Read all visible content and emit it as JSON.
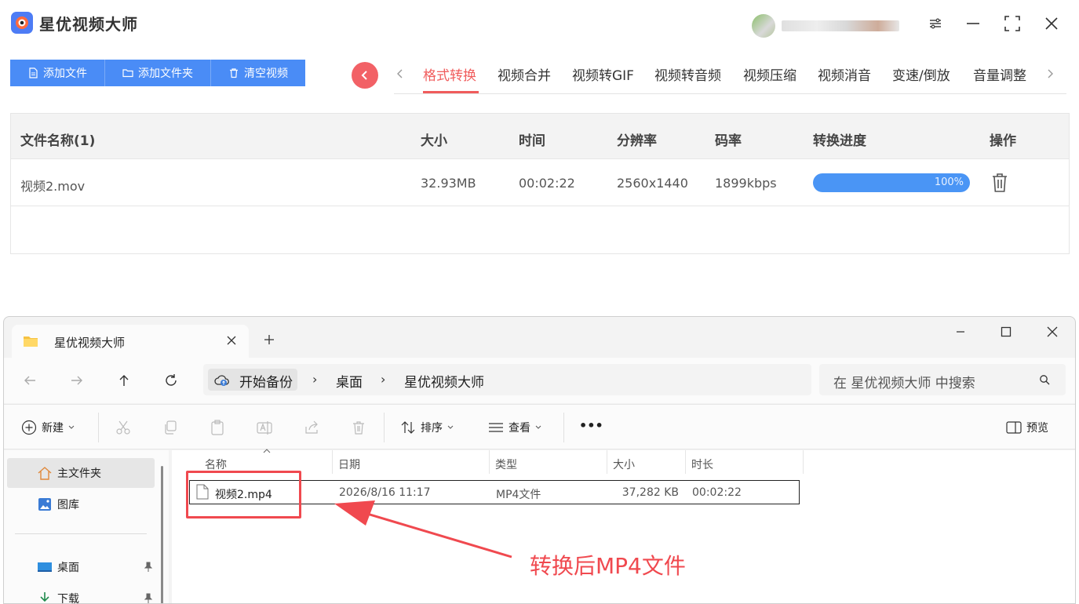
{
  "app": {
    "title": "星优视频大师",
    "window_controls": [
      "settings-icon",
      "minimize-icon",
      "maximize-icon",
      "close-icon"
    ]
  },
  "toolbar": {
    "add_file": "添加文件",
    "add_folder": "添加文件夹",
    "clear_videos": "清空视频"
  },
  "tabs": [
    "格式转换",
    "视频合并",
    "视频转GIF",
    "视频转音频",
    "视频压缩",
    "视频消音",
    "变速/倒放",
    "音量调整"
  ],
  "active_tab": "格式转换",
  "table": {
    "headers": {
      "name": "文件名称(1)",
      "size": "大小",
      "time": "时间",
      "resolution": "分辨率",
      "bitrate": "码率",
      "progress": "转换进度",
      "action": "操作"
    },
    "rows": [
      {
        "name": "视频2.mov",
        "size": "32.93MB",
        "time": "00:02:22",
        "resolution": "2560x1440",
        "bitrate": "1899kbps",
        "progress_label": "100%",
        "progress_value": 1.0
      }
    ]
  },
  "explorer": {
    "tab_title": "星优视频大师",
    "breadcrumb": [
      "开始备份",
      "桌面",
      "星优视频大师"
    ],
    "search_placeholder": "在 星优视频大师 中搜索",
    "commands": {
      "new": "新建",
      "sort": "排序",
      "view": "查看",
      "more": "•••",
      "preview": "预览"
    },
    "sidebar": [
      {
        "label": "主文件夹",
        "icon": "home-icon"
      },
      {
        "label": "图库",
        "icon": "gallery-icon"
      },
      {
        "label": "桌面",
        "icon": "desktop-icon"
      },
      {
        "label": "下载",
        "icon": "download-icon"
      }
    ],
    "columns": {
      "name": "名称",
      "date": "日期",
      "type": "类型",
      "size": "大小",
      "duration": "时长"
    },
    "files": [
      {
        "name": "视频2.mp4",
        "date": "2026/8/16 11:17",
        "type": "MP4文件",
        "size": "37,282 KB",
        "duration": "00:02:22"
      }
    ]
  },
  "annotation": "转换后MP4文件",
  "colors": {
    "accent_blue": "#4a8cf6",
    "accent_red": "#f05c5c",
    "progress_blue": "#4a95f5"
  }
}
